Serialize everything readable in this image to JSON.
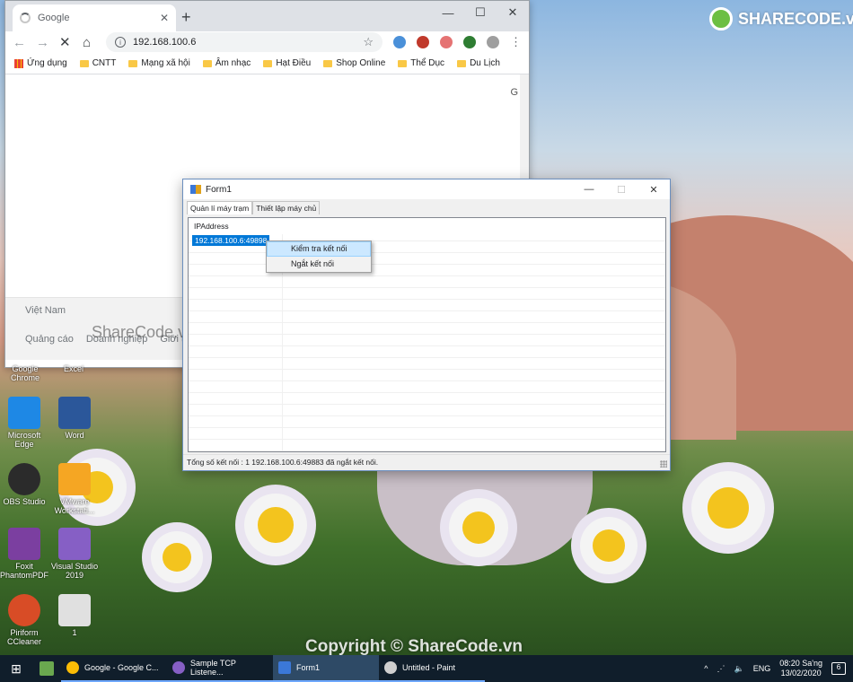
{
  "watermarks": {
    "brand": "SHARECODE.vn",
    "sharecode": "ShareCode.vn",
    "copyright": "Copyright © ShareCode.vn"
  },
  "chrome": {
    "tab_title": "Google",
    "url": "192.168.100.6",
    "bookmarks": [
      "Ứng dụng",
      "CNTT",
      "Mạng xã hội",
      "Âm nhạc",
      "Hạt Điều",
      "Shop Online",
      "Thể Dục",
      "Du Lịch"
    ],
    "page_right_letter": "G",
    "footer_country": "Việt Nam",
    "footer_links": [
      "Quảng cáo",
      "Doanh nghiệp",
      "Giới th"
    ]
  },
  "desktop_icons": [
    {
      "label": "Google Chrome",
      "color": "#dcdcdc"
    },
    {
      "label": "Excel",
      "color": "#1d6f42"
    },
    {
      "label": "Microsoft Edge",
      "color": "#1e88e5"
    },
    {
      "label": "Word",
      "color": "#2b579a"
    },
    {
      "label": "OBS Studio",
      "color": "#2b2b2b"
    },
    {
      "label": "VMware Workstati...",
      "color": "#f5a623"
    },
    {
      "label": "Foxit PhantomPDF",
      "color": "#7b3fa0"
    },
    {
      "label": "Visual Studio 2019",
      "color": "#865fc5"
    },
    {
      "label": "Piriform CCleaner",
      "color": "#d84c26"
    },
    {
      "label": "1",
      "color": "#e0e0e0"
    }
  ],
  "form": {
    "title": "Form1",
    "tabs": [
      "Quản lí máy trạm",
      "Thiết lập máy chủ"
    ],
    "column_header": "IPAddress",
    "rows": [
      "192.168.100.6:49898"
    ],
    "context_menu": [
      "Kiểm tra kết nối",
      "Ngắt kết nối"
    ],
    "status": "Tổng số kết nối : 1   192.168.100.6:49883 đã ngắt kết nối."
  },
  "taskbar": {
    "apps": [
      {
        "label": "Google - Google C...",
        "icon_color": "#fbbc05"
      },
      {
        "label": "Sample TCP Listene...",
        "icon_color": "#865fc5"
      },
      {
        "label": "Form1",
        "icon_color": "#3b78d8"
      },
      {
        "label": "Untitled - Paint",
        "icon_color": "#cfcfcf"
      }
    ],
    "language": "ENG",
    "time": "08:20 Sa'ng",
    "date": "13/02/2020",
    "notifications": "6"
  }
}
